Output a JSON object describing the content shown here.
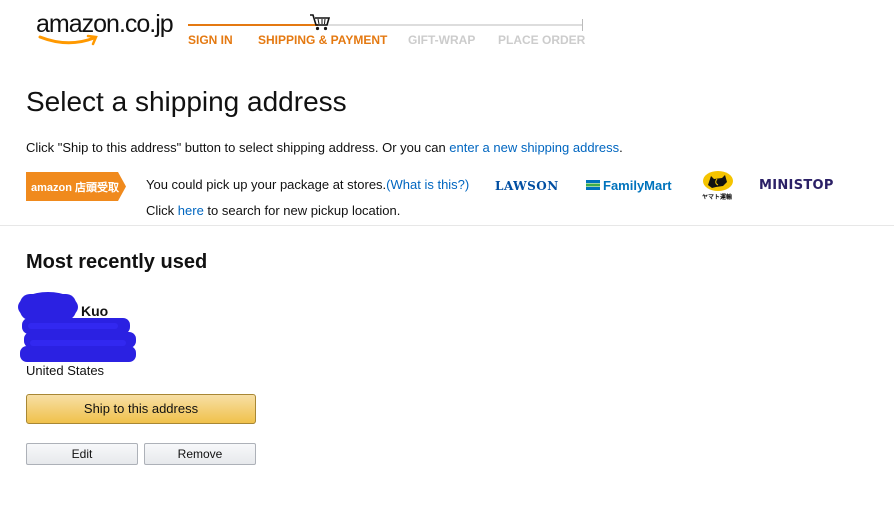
{
  "header": {
    "logo_text": "amazon.co.jp",
    "steps": [
      {
        "label": "SIGN IN",
        "state": "done"
      },
      {
        "label": "SHIPPING & PAYMENT",
        "state": "current"
      },
      {
        "label": "GIFT-WRAP",
        "state": "upcoming"
      },
      {
        "label": "PLACE ORDER",
        "state": "upcoming"
      }
    ],
    "accent_color": "#e47911"
  },
  "main": {
    "title": "Select a shipping address",
    "intro_text": "Click \"Ship to this address\" button to select shipping address. Or you can ",
    "intro_link": "enter a new shipping address",
    "intro_end": ".",
    "pickup": {
      "badge_text": "amazon 店頭受取",
      "line1_text": "You could pick up your package at stores.",
      "line1_link": "(What is this?)",
      "line2_prefix": "Click ",
      "line2_link": "here",
      "line2_suffix": " to search for new pickup location.",
      "stores": [
        "LAWSON",
        "FamilyMart",
        "ヤマト運輸",
        "MINISTOP"
      ]
    }
  },
  "recent": {
    "section_title": "Most recently used",
    "address": {
      "name_visible": "Kuo",
      "country": "United States"
    },
    "ship_button_label": "Ship to this address",
    "edit_button_label": "Edit",
    "remove_button_label": "Remove"
  }
}
